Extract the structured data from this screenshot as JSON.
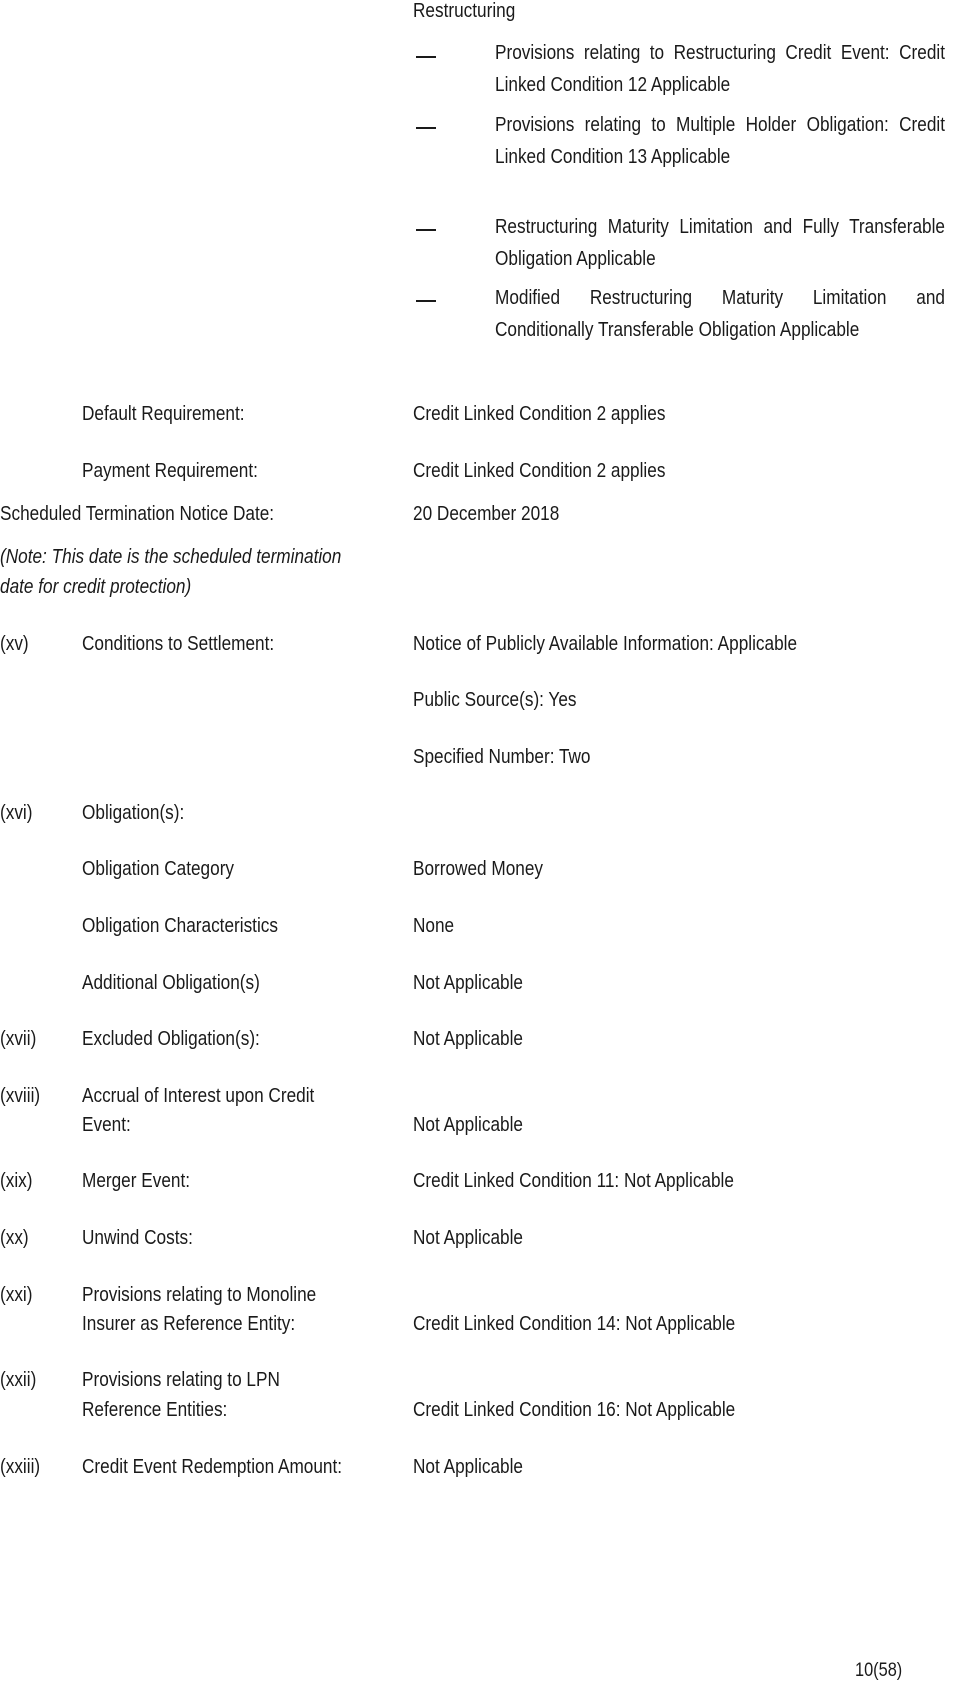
{
  "restructuring": {
    "heading": "Restructuring",
    "bullets": [
      "Provisions relating to Restructuring Credit Event: Credit Linked Condition 12 Applicable",
      "Provisions relating to Multiple Holder Obligation: Credit Linked Condition 13 Applicable",
      "Restructuring Maturity Limitation and Fully Transferable Obligation Applicable",
      "Modified Restructuring Maturity Limitation and Conditionally Transferable Obligation Applicable"
    ]
  },
  "requirements": [
    {
      "label": "Default Requirement:",
      "value": "Credit Linked Condition 2 applies"
    },
    {
      "label": "Payment Requirement:",
      "value": "Credit Linked Condition 2 applies"
    }
  ],
  "termination": {
    "label": "Scheduled Termination Notice Date:",
    "value": "20 December 2018",
    "note_line1": "(Note: This date is the scheduled termination",
    "note_line2": "date for credit protection)"
  },
  "items": {
    "xv": {
      "num": "(xv)",
      "label": "Conditions to Settlement:",
      "values": [
        "Notice of Publicly Available Information: Applicable",
        "Public Source(s): Yes",
        "Specified Number:  Two"
      ]
    },
    "xvi": {
      "num": "(xvi)",
      "label": "Obligation(s):",
      "rows": [
        {
          "label": "Obligation Category",
          "value": "Borrowed Money"
        },
        {
          "label": "Obligation Characteristics",
          "value": "None"
        },
        {
          "label": "Additional Obligation(s)",
          "value": "Not Applicable"
        }
      ]
    },
    "xvii": {
      "num": "(xvii)",
      "label": "Excluded Obligation(s):",
      "value": "Not Applicable"
    },
    "xviii": {
      "num": "(xviii)",
      "label_line1": "Accrual of Interest upon Credit",
      "label_line2": "Event:",
      "value": "Not Applicable"
    },
    "xix": {
      "num": "(xix)",
      "label": "Merger Event:",
      "value": "Credit Linked Condition 11: Not Applicable"
    },
    "xx": {
      "num": "(xx)",
      "label": "Unwind Costs:",
      "value": "Not Applicable"
    },
    "xxi": {
      "num": "(xxi)",
      "label_line1": "Provisions relating to Monoline",
      "label_line2": "Insurer as Reference Entity:",
      "value": "Credit Linked Condition 14: Not Applicable"
    },
    "xxii": {
      "num": "(xxii)",
      "label_line1": "Provisions relating to LPN",
      "label_line2": "Reference Entities:",
      "value": "Credit Linked Condition 16: Not Applicable"
    },
    "xxiii": {
      "num": "(xxiii)",
      "label": "Credit Event Redemption Amount:",
      "value": "Not Applicable"
    }
  },
  "page_number": "10(58)"
}
